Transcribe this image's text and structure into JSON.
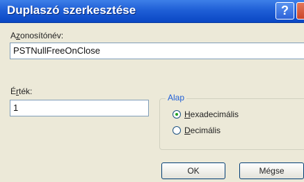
{
  "window": {
    "title": "Duplaszó szerkesztése",
    "help_glyph": "?",
    "accent_color": "#1F5FD6"
  },
  "name_field": {
    "label_first": "A",
    "label_accel": "z",
    "label_rest": "onosítónév:",
    "value": "PSTNullFreeOnClose"
  },
  "value_field": {
    "label_first": "É",
    "label_accel": "r",
    "label_rest": "ték:",
    "value": "1"
  },
  "base_group": {
    "legend": "Alap",
    "options": [
      {
        "accel": "H",
        "rest": "exadecimális",
        "checked": true
      },
      {
        "accel": "D",
        "rest": "ecimális",
        "checked": false
      }
    ]
  },
  "buttons": {
    "ok": "OK",
    "cancel": "Mégse"
  }
}
